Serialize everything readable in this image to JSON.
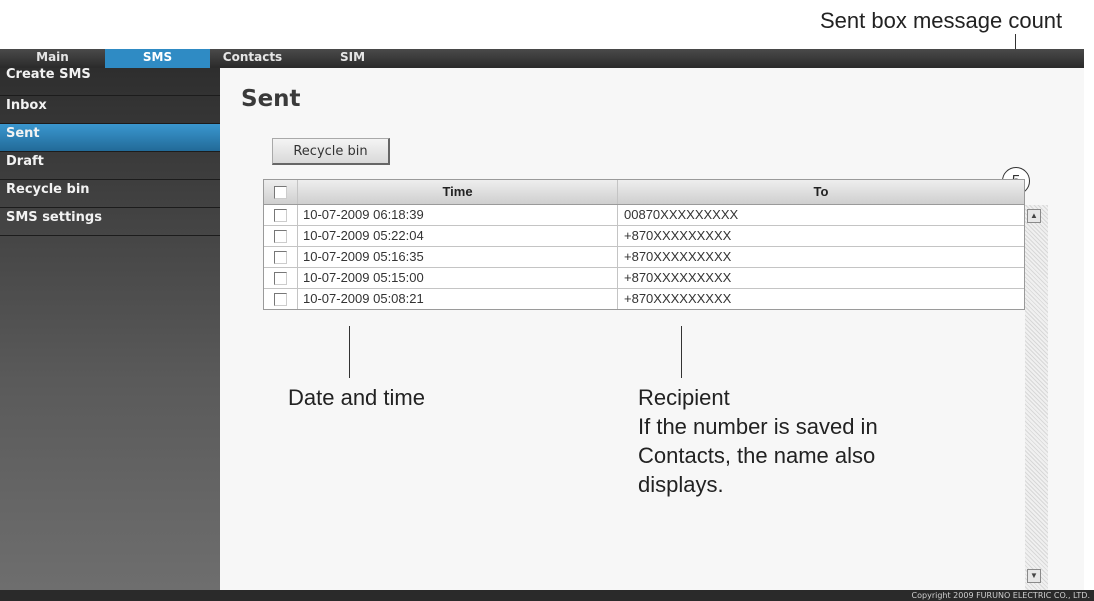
{
  "annotations": {
    "count_label": "Sent box message count",
    "datetime_label": "Date and time",
    "recipient_title": "Recipient",
    "recipient_lines": [
      "If the number is saved in",
      "Contacts, the name also",
      "displays."
    ]
  },
  "topnav": {
    "tabs": [
      {
        "label": "Main"
      },
      {
        "label": "SMS"
      },
      {
        "label": "Contacts"
      },
      {
        "label": "SIM"
      }
    ],
    "active": "SMS"
  },
  "sidebar": {
    "items": [
      {
        "label": "Create SMS"
      },
      {
        "label": "Inbox"
      },
      {
        "label": "Sent"
      },
      {
        "label": "Draft"
      },
      {
        "label": "Recycle bin"
      },
      {
        "label": "SMS settings"
      }
    ],
    "active": "Sent"
  },
  "main": {
    "title": "Sent",
    "recycle_button": "Recycle bin",
    "message_count": "5",
    "table": {
      "headers": {
        "time": "Time",
        "to": "To"
      },
      "rows": [
        {
          "time": "10-07-2009 06:18:39",
          "to": "00870XXXXXXXXX"
        },
        {
          "time": "10-07-2009 05:22:04",
          "to": "+870XXXXXXXXX"
        },
        {
          "time": "10-07-2009 05:16:35",
          "to": "+870XXXXXXXXX"
        },
        {
          "time": "10-07-2009 05:15:00",
          "to": "+870XXXXXXXXX"
        },
        {
          "time": "10-07-2009 05:08:21",
          "to": "+870XXXXXXXXX"
        }
      ]
    }
  },
  "footer": {
    "copyright": "Copyright 2009 FURUNO ELECTRIC CO., LTD."
  },
  "colors": {
    "accent": "#2f8bc4",
    "nav_bg": "#2a2a2a"
  }
}
